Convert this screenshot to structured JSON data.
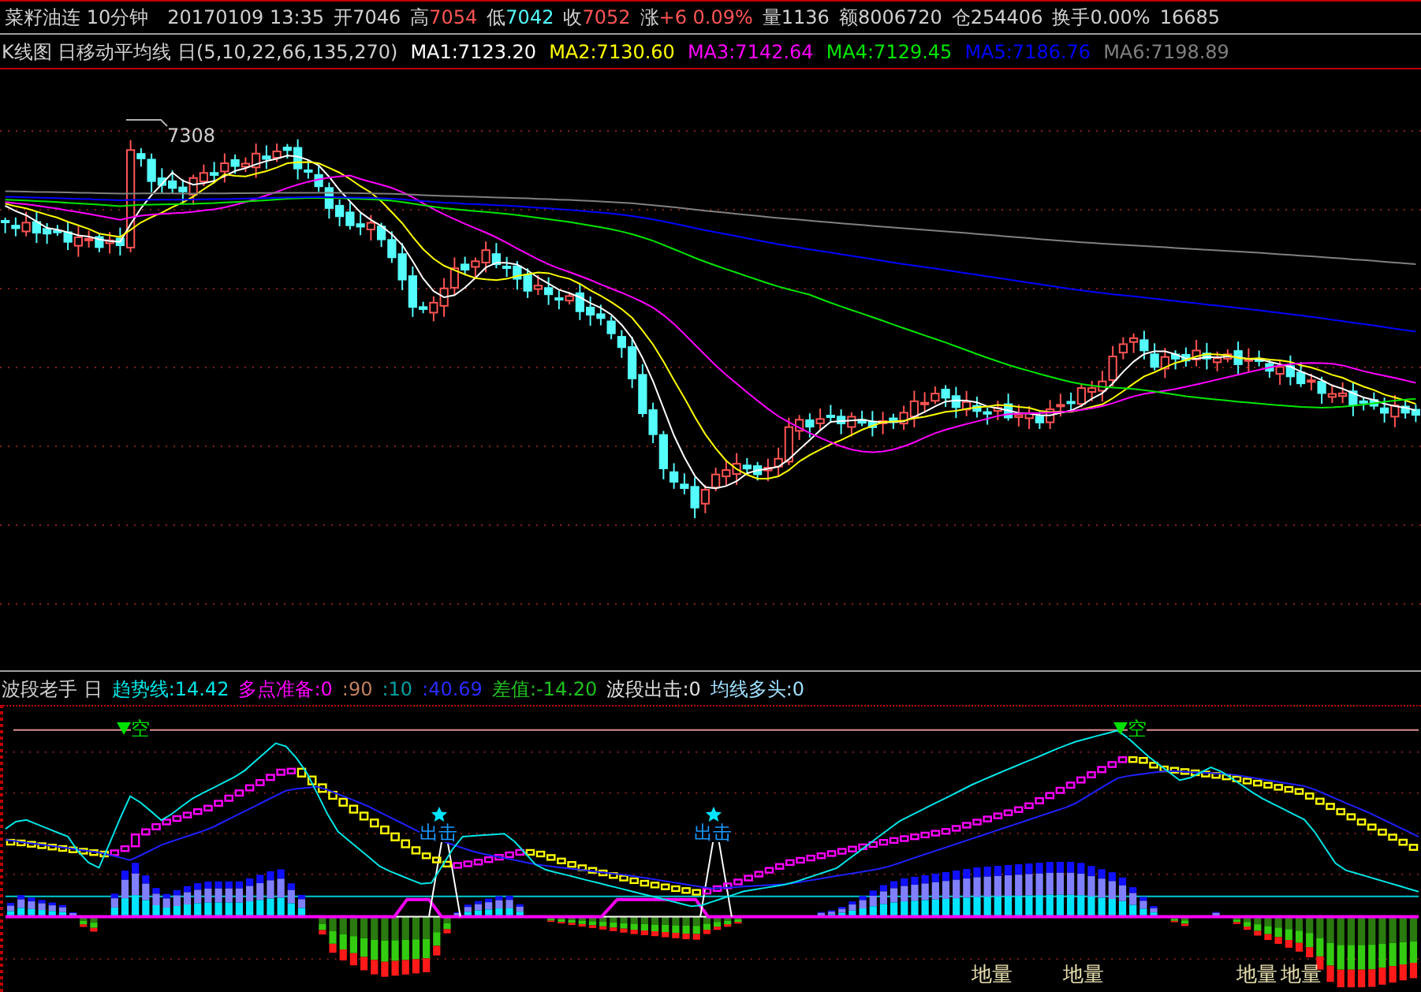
{
  "header": {
    "title": "菜籽油连 10分钟",
    "datetime": "20170109 13:35",
    "quotes": [
      {
        "label": "开",
        "value": "7046",
        "color": "#d0d0d0"
      },
      {
        "label": "高",
        "value": "7054",
        "color": "#ff5454"
      },
      {
        "label": "低",
        "value": "7042",
        "color": "#54fcfc"
      },
      {
        "label": "收",
        "value": "7052",
        "color": "#ff5454"
      },
      {
        "label": "涨",
        "value": "+6 0.09%",
        "color": "#ff5454"
      },
      {
        "label": "量",
        "value": "1136",
        "color": "#d0d0d0"
      },
      {
        "label": "额",
        "value": "8006720",
        "color": "#d0d0d0"
      },
      {
        "label": "仓",
        "value": "254406",
        "color": "#d0d0d0"
      },
      {
        "label": "换手",
        "value": "0.00%",
        "color": "#d0d0d0"
      }
    ],
    "extra": "16685"
  },
  "main_chart": {
    "legend_title": "K线图 日移动平均线 日(5,10,22,66,135,270)",
    "averages": [
      {
        "label": "MA1:7123.20",
        "color": "#ffffff"
      },
      {
        "label": "MA2:7130.60",
        "color": "#ffff00"
      },
      {
        "label": "MA3:7142.64",
        "color": "#ff00ff"
      },
      {
        "label": "MA4:7129.45",
        "color": "#00e600"
      },
      {
        "label": "MA5:7186.76",
        "color": "#0000ff"
      },
      {
        "label": "MA6:7198.89",
        "color": "#808080"
      }
    ],
    "high_label": "7308"
  },
  "indicator": {
    "title": "波段老手 日",
    "values": [
      {
        "label": "趋势线:14.42",
        "color": "#00e5e5"
      },
      {
        "label": "多点准备:0",
        "color": "#ff00ff"
      },
      {
        "label": ":90",
        "color": "#c08060"
      },
      {
        "label": ":10",
        "color": "#00a0a0"
      },
      {
        "label": ":40.69",
        "color": "#2b2bff"
      },
      {
        "label": "差值:-14.20",
        "color": "#20c020"
      },
      {
        "label": "波段出击:0",
        "color": "#e0e0e0"
      },
      {
        "label": "均线多头:0",
        "color": "#a0e0ff"
      }
    ],
    "signals": [
      {
        "kind": "sell",
        "text": "空"
      },
      {
        "kind": "attack",
        "text": "出击"
      },
      {
        "kind": "attack",
        "text": "出击"
      },
      {
        "kind": "sell",
        "text": "空"
      }
    ],
    "bottom_labels": [
      "地量",
      "地量",
      "地量",
      "地量"
    ]
  }
}
